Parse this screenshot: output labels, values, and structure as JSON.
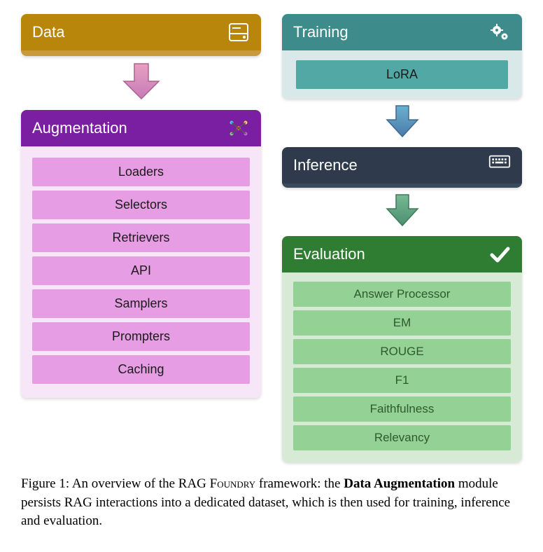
{
  "data_box": {
    "title": "Data"
  },
  "augmentation": {
    "title": "Augmentation",
    "items": [
      "Loaders",
      "Selectors",
      "Retrievers",
      "API",
      "Samplers",
      "Prompters",
      "Caching"
    ]
  },
  "training": {
    "title": "Training",
    "items": [
      "LoRA"
    ]
  },
  "inference": {
    "title": "Inference"
  },
  "evaluation": {
    "title": "Evaluation",
    "items": [
      "Answer Processor",
      "EM",
      "ROUGE",
      "F1",
      "Faithfulness",
      "Relevancy"
    ]
  },
  "caption": {
    "prefix": "Figure 1: An overview of the RAG ",
    "smallcaps": "Foundry",
    "mid": " framework: the ",
    "bold": "Data Augmentation",
    "suffix": " module persists RAG interactions into a dedicated dataset, which is then used for training, inference and evaluation."
  }
}
